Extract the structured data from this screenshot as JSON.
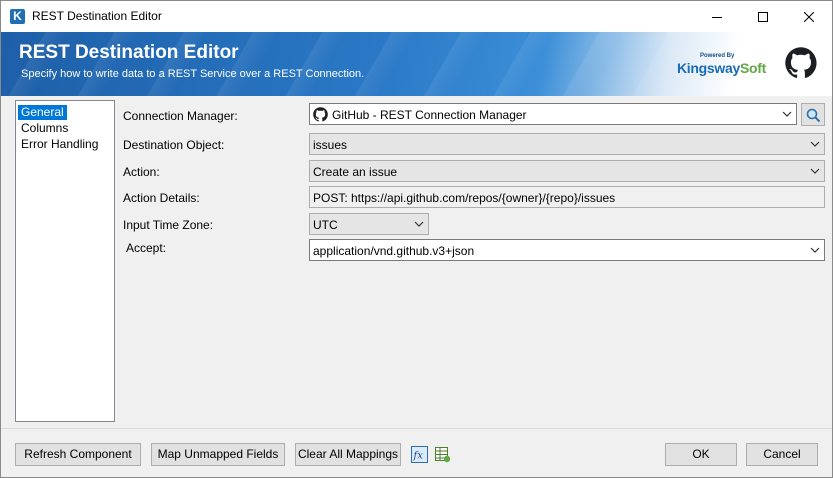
{
  "window": {
    "title": "REST Destination Editor",
    "app_icon_letter": "K"
  },
  "banner": {
    "title": "REST Destination Editor",
    "subtitle": "Specify how to write data to a REST Service over a REST Connection.",
    "powered_by": "Powered By",
    "brand_main": "Kingsway",
    "brand_accent": "Soft"
  },
  "nav": {
    "items": [
      {
        "label": "General",
        "selected": true
      },
      {
        "label": "Columns",
        "selected": false
      },
      {
        "label": "Error Handling",
        "selected": false
      }
    ]
  },
  "form": {
    "connection_manager": {
      "label": "Connection Manager:",
      "value": "GitHub - REST Connection Manager"
    },
    "destination_object": {
      "label": "Destination Object:",
      "value": "issues"
    },
    "action": {
      "label": "Action:",
      "value": "Create an issue"
    },
    "action_details": {
      "label": "Action Details:",
      "value": "POST: https://api.github.com/repos/{owner}/{repo}/issues"
    },
    "input_time_zone": {
      "label": "Input Time Zone:",
      "value": "UTC"
    },
    "accept": {
      "label": "Accept:",
      "value": "application/vnd.github.v3+json"
    }
  },
  "buttons": {
    "refresh": "Refresh Component",
    "map_unmapped": "Map Unmapped Fields",
    "clear_mappings": "Clear All Mappings",
    "ok": "OK",
    "cancel": "Cancel"
  },
  "colors": {
    "accent": "#0078d7",
    "banner_blue": "#1d5fa8"
  }
}
